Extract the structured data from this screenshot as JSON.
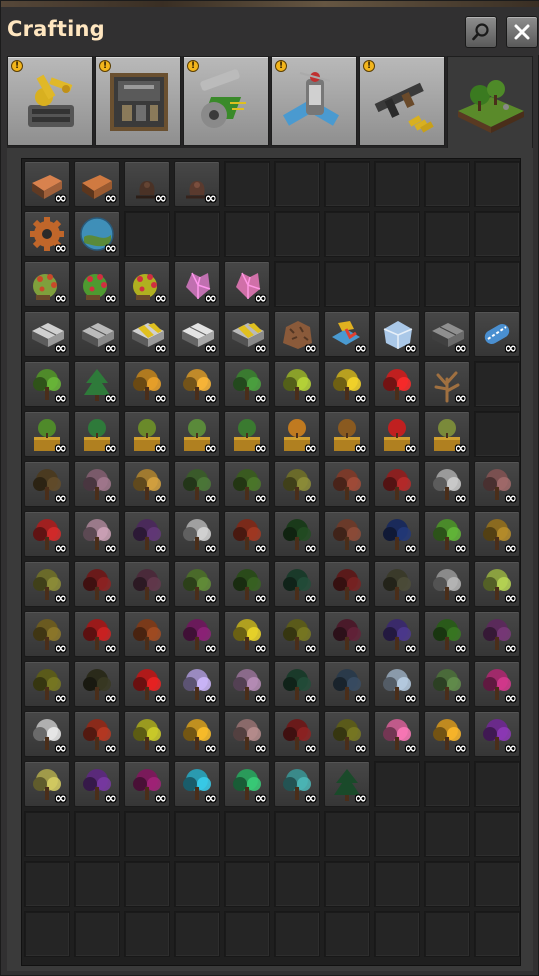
{
  "window": {
    "title": "Crafting"
  },
  "buttons": {
    "search_icon": "magnifier-icon",
    "close_icon": "close-icon"
  },
  "colors": {
    "title": "#ffe6c0",
    "warning": "#f2b51c",
    "background": "#313031"
  },
  "tabs": [
    {
      "name": "logistics",
      "icon": "logistics-tab-icon",
      "warning": true,
      "active": false
    },
    {
      "name": "production",
      "icon": "production-tab-icon",
      "warning": true,
      "active": false
    },
    {
      "name": "intermediate-products",
      "icon": "intermediate-products-tab-icon",
      "warning": true,
      "active": false
    },
    {
      "name": "space",
      "icon": "space-tab-icon",
      "warning": true,
      "active": false
    },
    {
      "name": "combat",
      "icon": "combat-tab-icon",
      "warning": true,
      "active": false
    },
    {
      "name": "environment",
      "icon": "environment-tab-icon",
      "warning": false,
      "active": true
    }
  ],
  "count_label": "∞",
  "rows": [
    {
      "items": [
        {
          "k": "wood",
          "c": "#a0603a"
        },
        {
          "k": "wood",
          "c": "#9a5a30"
        },
        {
          "k": "stump",
          "c": "#4a3226"
        },
        {
          "k": "stump",
          "c": "#5a3a2e"
        }
      ]
    },
    {
      "items": [
        {
          "k": "gear",
          "c": "#c0662a"
        },
        {
          "k": "planet",
          "c": "#3f8fb8"
        }
      ]
    },
    {
      "items": [
        {
          "k": "fruit",
          "c": "#7fa03c",
          "c2": "#c84a2a"
        },
        {
          "k": "fruit",
          "c": "#4e9a30",
          "c2": "#d03040"
        },
        {
          "k": "fruit",
          "c": "#b0b020",
          "c2": "#d03040"
        },
        {
          "k": "crystal",
          "c": "#c070b0"
        },
        {
          "k": "crystal",
          "c": "#d070a8"
        }
      ]
    },
    {
      "items": [
        {
          "k": "tile",
          "c": "#9a9a9a"
        },
        {
          "k": "tile",
          "c": "#8a8a8a"
        },
        {
          "k": "hazard",
          "c": "#9a9a9a"
        },
        {
          "k": "tile",
          "c": "#a8a8a8"
        },
        {
          "k": "hazard",
          "c": "#8a8a8a"
        },
        {
          "k": "rock",
          "c": "#8a5a3a"
        },
        {
          "k": "refined",
          "c": "#e0b020"
        },
        {
          "k": "ice",
          "c": "#aac8e8"
        },
        {
          "k": "tile",
          "c": "#6a6a6a"
        },
        {
          "k": "cable",
          "c": "#4a8fd0"
        }
      ]
    },
    {
      "items": [
        {
          "k": "tree",
          "c": "#4f8a2a"
        },
        {
          "k": "pine",
          "c": "#2e7a3a"
        },
        {
          "k": "tree",
          "c": "#b07a20"
        },
        {
          "k": "tree",
          "c": "#c08a2a"
        },
        {
          "k": "tree",
          "c": "#3a7a30"
        },
        {
          "k": "tree",
          "c": "#8aa02a"
        },
        {
          "k": "tree",
          "c": "#b8a020"
        },
        {
          "k": "tree",
          "c": "#c02020"
        },
        {
          "k": "dead",
          "c": "#a07040"
        }
      ]
    },
    {
      "items": [
        {
          "k": "sapling",
          "c": "#4f8a2a"
        },
        {
          "k": "sapling",
          "c": "#2e7a3a"
        },
        {
          "k": "sapling",
          "c": "#6a8a2a"
        },
        {
          "k": "sapling",
          "c": "#5a8a3a"
        },
        {
          "k": "sapling",
          "c": "#3a7a30"
        },
        {
          "k": "sapling",
          "c": "#c07a20"
        },
        {
          "k": "sapling",
          "c": "#8a5a20"
        },
        {
          "k": "sapling",
          "c": "#c02020"
        },
        {
          "k": "sapling",
          "c": "#7a8a3a"
        }
      ]
    },
    {
      "items": [
        {
          "k": "tree",
          "c": "#4a3a20"
        },
        {
          "k": "tree",
          "c": "#7a5a6a"
        },
        {
          "k": "tree",
          "c": "#a07a30"
        },
        {
          "k": "tree",
          "c": "#3a5a2a"
        },
        {
          "k": "tree",
          "c": "#3a5a20"
        },
        {
          "k": "tree",
          "c": "#6a6a2a"
        },
        {
          "k": "tree",
          "c": "#7a3a2a"
        },
        {
          "k": "tree",
          "c": "#8a2020"
        },
        {
          "k": "tree",
          "c": "#9a9a9a"
        },
        {
          "k": "tree",
          "c": "#7a5050"
        }
      ]
    },
    {
      "items": [
        {
          "k": "tree",
          "c": "#a02020"
        },
        {
          "k": "tree",
          "c": "#9a7a8a"
        },
        {
          "k": "tree",
          "c": "#4a2a5a"
        },
        {
          "k": "tree",
          "c": "#a0a0a0"
        },
        {
          "k": "tree",
          "c": "#7a2a1a"
        },
        {
          "k": "tree",
          "c": "#1a3a1a"
        },
        {
          "k": "tree",
          "c": "#6a3a2a"
        },
        {
          "k": "tree",
          "c": "#1a2a5a"
        },
        {
          "k": "tree",
          "c": "#4a8a2a"
        },
        {
          "k": "tree",
          "c": "#8a6a20"
        }
      ]
    },
    {
      "items": [
        {
          "k": "tree",
          "c": "#6a6a2a"
        },
        {
          "k": "tree",
          "c": "#6a1a1a"
        },
        {
          "k": "tree",
          "c": "#4a2a3a"
        },
        {
          "k": "tree",
          "c": "#4a6a2a"
        },
        {
          "k": "tree",
          "c": "#2a4a1a"
        },
        {
          "k": "tree",
          "c": "#1a3a2a"
        },
        {
          "k": "tree",
          "c": "#5a1a1a"
        },
        {
          "k": "tree",
          "c": "#3a3a2a"
        },
        {
          "k": "tree",
          "c": "#8a8a8a"
        },
        {
          "k": "tree",
          "c": "#8aa040"
        }
      ]
    },
    {
      "items": [
        {
          "k": "tree",
          "c": "#6a5a20"
        },
        {
          "k": "tree",
          "c": "#9a1a1a"
        },
        {
          "k": "tree",
          "c": "#7a3a1a"
        },
        {
          "k": "tree",
          "c": "#6a1a5a"
        },
        {
          "k": "tree",
          "c": "#b0a020"
        },
        {
          "k": "tree",
          "c": "#5a5a1a"
        },
        {
          "k": "tree",
          "c": "#4a1a2a"
        },
        {
          "k": "tree",
          "c": "#3a2a6a"
        },
        {
          "k": "tree",
          "c": "#2a5a1a"
        },
        {
          "k": "tree",
          "c": "#5a2a5a"
        }
      ]
    },
    {
      "items": [
        {
          "k": "tree",
          "c": "#5a5a1a"
        },
        {
          "k": "tree",
          "c": "#2a2a1a"
        },
        {
          "k": "tree",
          "c": "#b01a1a"
        },
        {
          "k": "tree",
          "c": "#9a8ac0"
        },
        {
          "k": "tree",
          "c": "#8a6a8a"
        },
        {
          "k": "tree",
          "c": "#1a3a2a"
        },
        {
          "k": "tree",
          "c": "#2a3a4a"
        },
        {
          "k": "tree",
          "c": "#8a9aaa"
        },
        {
          "k": "tree",
          "c": "#4a6a3a"
        },
        {
          "k": "tree",
          "c": "#a02a6a"
        }
      ]
    },
    {
      "items": [
        {
          "k": "tree",
          "c": "#b0b0b0"
        },
        {
          "k": "tree",
          "c": "#8a2a1a"
        },
        {
          "k": "tree",
          "c": "#9a9a20"
        },
        {
          "k": "tree",
          "c": "#c09020"
        },
        {
          "k": "tree",
          "c": "#8a6a6a"
        },
        {
          "k": "tree",
          "c": "#6a1a1a"
        },
        {
          "k": "tree",
          "c": "#5a5a1a"
        },
        {
          "k": "tree",
          "c": "#c05a8a"
        },
        {
          "k": "tree",
          "c": "#c08a20"
        },
        {
          "k": "tree",
          "c": "#6a2a8a"
        }
      ]
    },
    {
      "items": [
        {
          "k": "tree",
          "c": "#a09a4a"
        },
        {
          "k": "tree",
          "c": "#5a2a7a"
        },
        {
          "k": "tree",
          "c": "#7a1a5a"
        },
        {
          "k": "tree",
          "c": "#2a9ab0"
        },
        {
          "k": "tree",
          "c": "#2a9a5a"
        },
        {
          "k": "tree",
          "c": "#3a8a8a"
        },
        {
          "k": "pine",
          "c": "#1a4a2a"
        }
      ]
    },
    {
      "items": []
    },
    {
      "items": []
    },
    {
      "items": []
    }
  ]
}
